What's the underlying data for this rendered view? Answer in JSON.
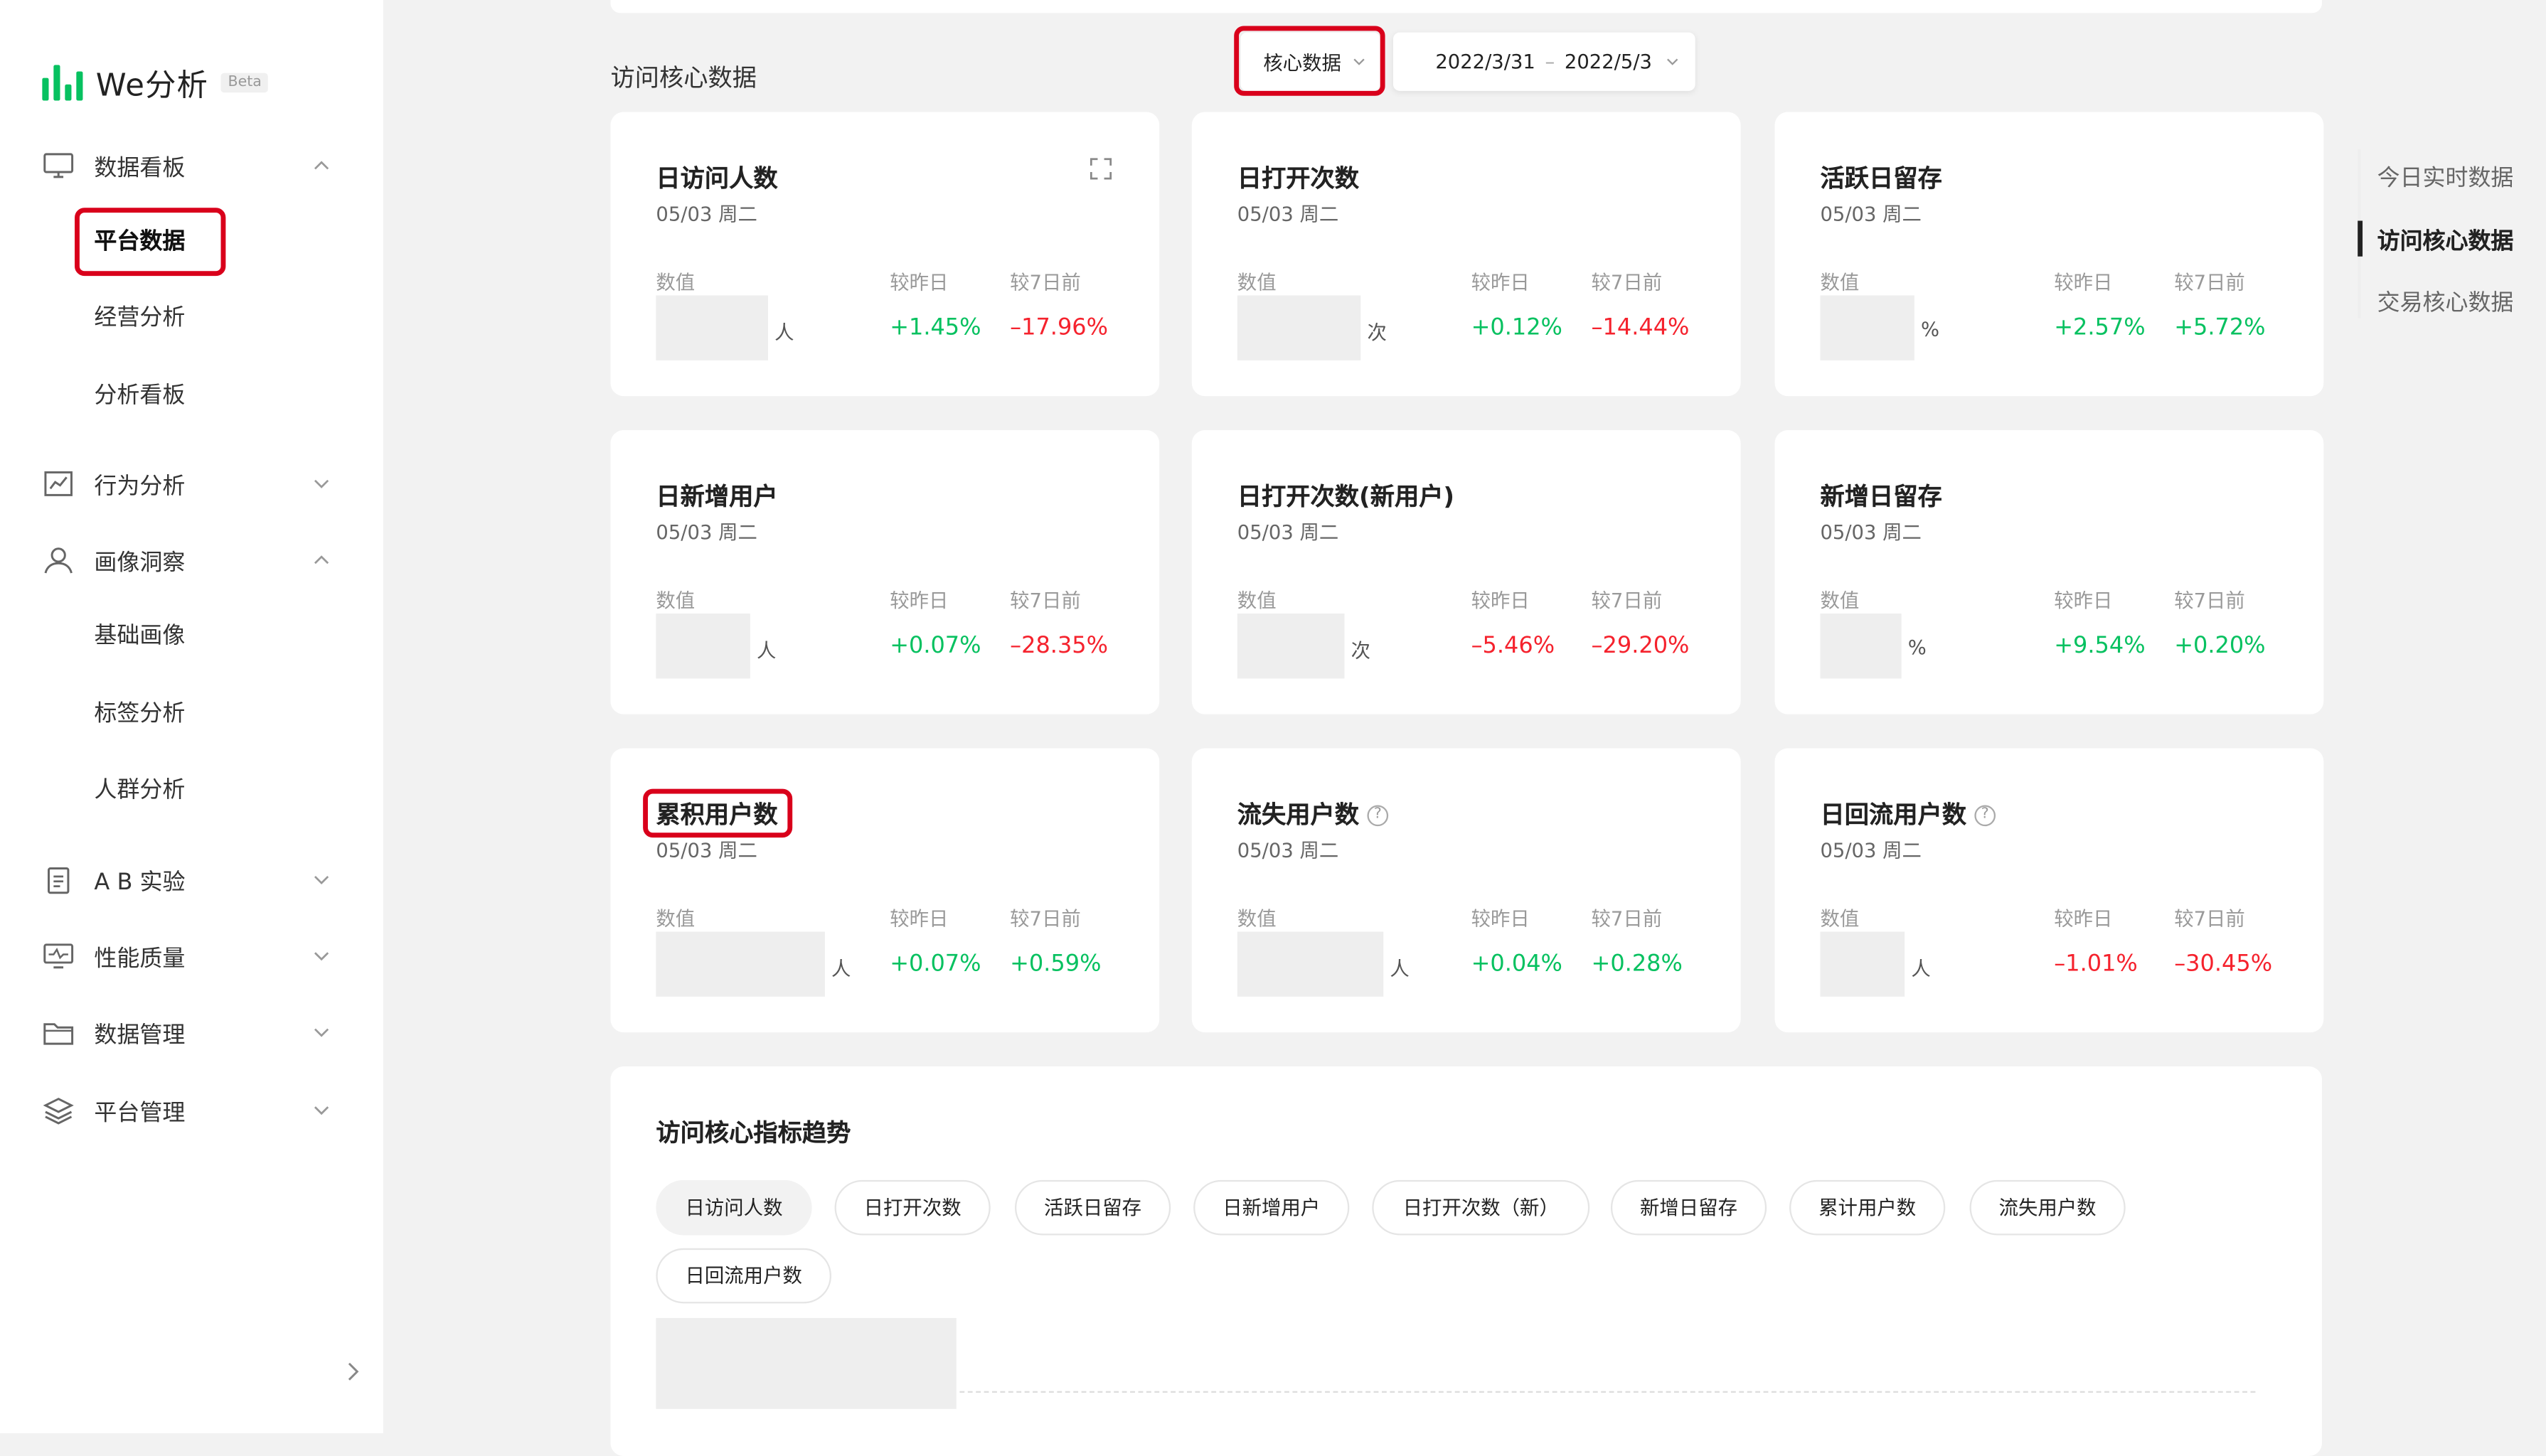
{
  "app": {
    "name": "We分析",
    "badge": "Beta"
  },
  "sidebar": {
    "groups": [
      {
        "label": "数据看板",
        "icon": "monitor-icon",
        "expanded": true,
        "items": [
          "平台数据",
          "经营分析",
          "分析看板"
        ]
      },
      {
        "label": "行为分析",
        "icon": "line-chart-icon",
        "expanded": false,
        "items": []
      },
      {
        "label": "画像洞察",
        "icon": "user-icon",
        "expanded": true,
        "items": [
          "基础画像",
          "标签分析",
          "人群分析"
        ]
      },
      {
        "label": "A B 实验",
        "icon": "clipboard-icon",
        "expanded": false,
        "items": []
      },
      {
        "label": "性能质量",
        "icon": "performance-icon",
        "expanded": false,
        "items": []
      },
      {
        "label": "数据管理",
        "icon": "folder-icon",
        "expanded": false,
        "items": []
      },
      {
        "label": "平台管理",
        "icon": "layers-icon",
        "expanded": false,
        "items": []
      }
    ]
  },
  "filters": {
    "category": "核心数据",
    "date_start": "2022/3/31",
    "date_sep": "–",
    "date_end": "2022/5/3"
  },
  "section_title": "访问核心数据",
  "labels": {
    "value": "数值",
    "vs_yesterday": "较昨日",
    "vs_7days": "较7日前"
  },
  "cards": [
    {
      "title": "日访问人数",
      "date": "05/03 周二",
      "unit": "人",
      "d1": "+1.45%",
      "d1_dir": "up",
      "d7": "–17.96%",
      "d7_dir": "down",
      "help": false,
      "expand": true
    },
    {
      "title": "日打开次数",
      "date": "05/03 周二",
      "unit": "次",
      "d1": "+0.12%",
      "d1_dir": "up",
      "d7": "–14.44%",
      "d7_dir": "down",
      "help": false,
      "expand": false
    },
    {
      "title": "活跃日留存",
      "date": "05/03 周二",
      "unit": "%",
      "d1": "+2.57%",
      "d1_dir": "up",
      "d7": "+5.72%",
      "d7_dir": "up",
      "help": false,
      "expand": false
    },
    {
      "title": "日新增用户",
      "date": "05/03 周二",
      "unit": "人",
      "d1": "+0.07%",
      "d1_dir": "up",
      "d7": "–28.35%",
      "d7_dir": "down",
      "help": false,
      "expand": false
    },
    {
      "title": "日打开次数(新用户)",
      "date": "05/03 周二",
      "unit": "次",
      "d1": "–5.46%",
      "d1_dir": "down",
      "d7": "–29.20%",
      "d7_dir": "down",
      "help": false,
      "expand": false
    },
    {
      "title": "新增日留存",
      "date": "05/03 周二",
      "unit": "%",
      "d1": "+9.54%",
      "d1_dir": "up",
      "d7": "+0.20%",
      "d7_dir": "up",
      "help": false,
      "expand": false
    },
    {
      "title": "累积用户数",
      "date": "05/03 周二",
      "unit": "人",
      "d1": "+0.07%",
      "d1_dir": "up",
      "d7": "+0.59%",
      "d7_dir": "up",
      "help": false,
      "expand": false
    },
    {
      "title": "流失用户数",
      "date": "05/03 周二",
      "unit": "人",
      "d1": "+0.04%",
      "d1_dir": "up",
      "d7": "+0.28%",
      "d7_dir": "up",
      "help": true,
      "expand": false
    },
    {
      "title": "日回流用户数",
      "date": "05/03 周二",
      "unit": "人",
      "d1": "–1.01%",
      "d1_dir": "down",
      "d7": "–30.45%",
      "d7_dir": "down",
      "help": true,
      "expand": false
    }
  ],
  "trend": {
    "title": "访问核心指标趋势",
    "pills": [
      "日访问人数",
      "日打开次数",
      "活跃日留存",
      "日新增用户",
      "日打开次数（新）",
      "新增日留存",
      "累计用户数",
      "流失用户数",
      "日回流用户数"
    ],
    "active": "日访问人数"
  },
  "anchors": {
    "items": [
      "今日实时数据",
      "访问核心数据",
      "交易核心数据"
    ],
    "active": "访问核心数据"
  },
  "colors": {
    "accent": "#07c160",
    "up": "#07c160",
    "down": "#f5222d",
    "highlight": "#d9001b"
  }
}
